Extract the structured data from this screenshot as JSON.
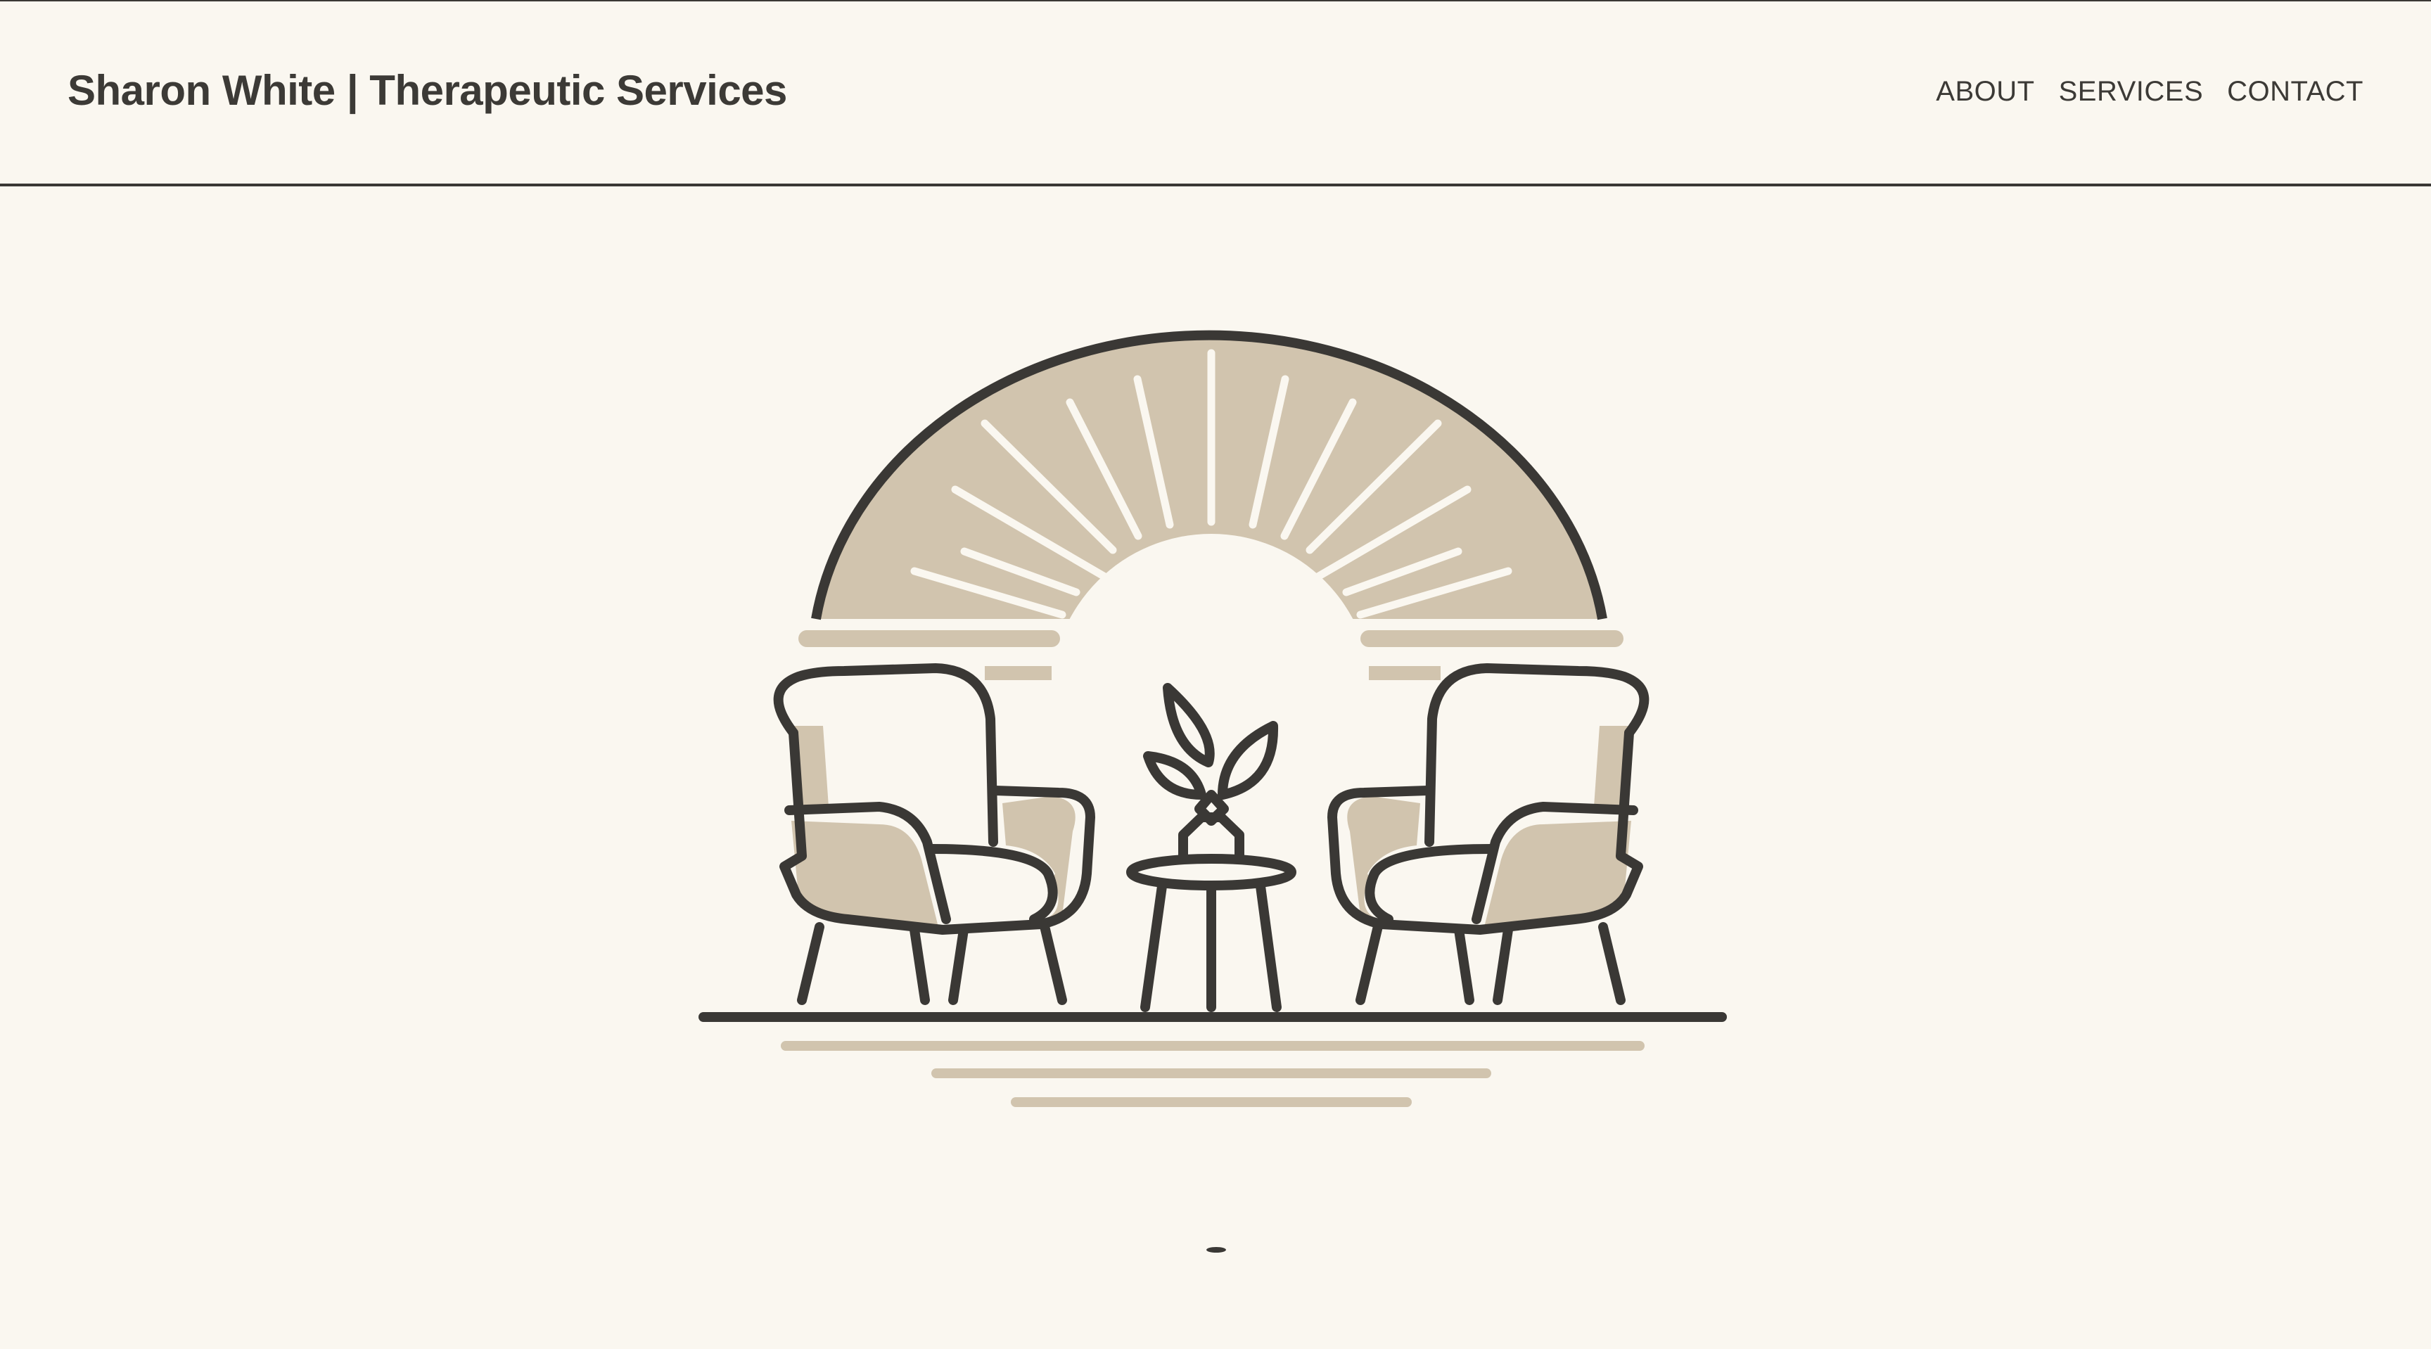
{
  "header": {
    "site_title": "Sharon White | Therapeutic Services",
    "nav": [
      {
        "label": "ABOUT"
      },
      {
        "label": "SERVICES"
      },
      {
        "label": "CONTACT"
      }
    ]
  },
  "hero": {
    "illustration": "two-armchairs-with-side-table-and-plant-under-rising-sun-icon"
  },
  "colors": {
    "background": "#faf7f0",
    "text": "#3c3a36",
    "line": "#3a3835",
    "beige": "#d1c4ae"
  }
}
